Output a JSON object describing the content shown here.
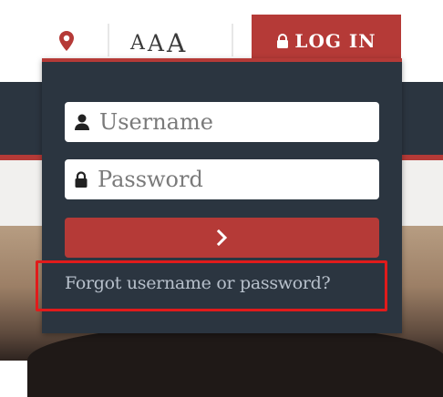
{
  "colors": {
    "accent": "#b53a37",
    "panel": "#2b3540",
    "highlight_box": "#e11b1b",
    "link_text": "#b7c0cb"
  },
  "utility_bar": {
    "location_icon": "map-pin-icon",
    "text_size_letters": [
      "A",
      "A",
      "A"
    ]
  },
  "login_tab": {
    "icon": "lock-icon",
    "label": "LOG IN"
  },
  "login_form": {
    "username": {
      "icon": "user-icon",
      "placeholder": "Username",
      "value": ""
    },
    "password": {
      "icon": "lock-icon",
      "placeholder": "Password",
      "value": ""
    },
    "submit_icon": "chevron-right-icon",
    "forgot_link": "Forgot username or password?"
  }
}
